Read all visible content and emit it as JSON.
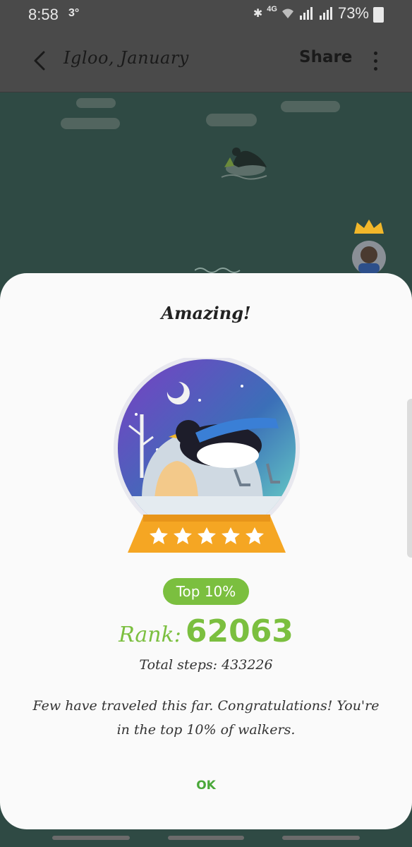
{
  "status_bar": {
    "time": "8:58",
    "temperature": "3°",
    "network": "4G",
    "battery_percent": "73%"
  },
  "app_bar": {
    "title": "Igloo, January",
    "share_label": "Share"
  },
  "dialog": {
    "title": "Amazing!",
    "badge": "Top 10%",
    "rank_label": "Rank:",
    "rank_value": "62063",
    "total_steps": "Total steps: 433226",
    "message": "Few have traveled this far. Congratulations! You're in the top 10% of walkers.",
    "ok_label": "OK",
    "stars": 5
  },
  "colors": {
    "accent_green": "#7bbf3f",
    "ok_green": "#4aa83a",
    "globe_base_orange": "#f5a623"
  },
  "icons": [
    "back-arrow-icon",
    "more-vert-icon",
    "bluetooth-icon",
    "wifi-icon",
    "signal-icon",
    "battery-icon",
    "crown-icon",
    "star-icon"
  ]
}
